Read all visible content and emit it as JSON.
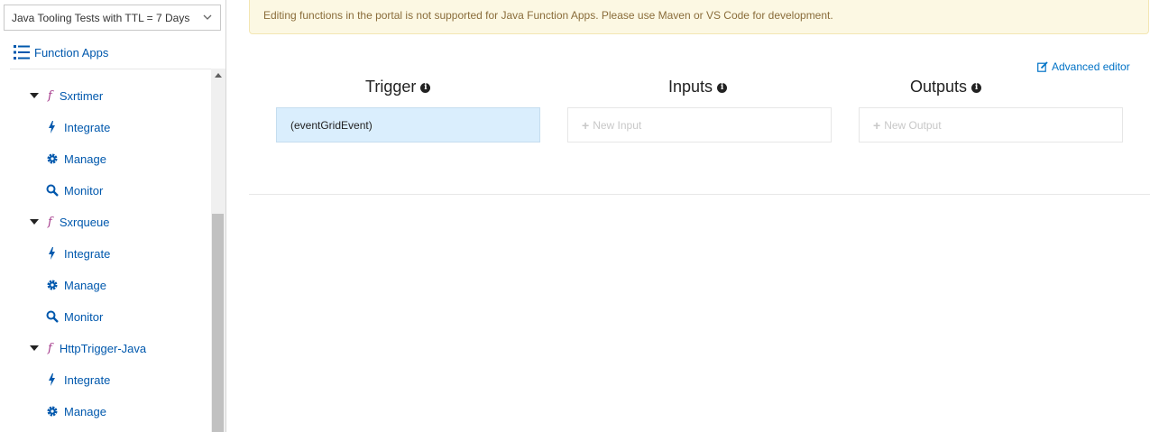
{
  "sidebar": {
    "subscription": "Java Tooling Tests with TTL = 7 Days",
    "header_label": "Function Apps",
    "tree": [
      {
        "kind": "function",
        "label": "Sxrtimer"
      },
      {
        "kind": "action",
        "icon": "lightning-icon",
        "label": "Integrate"
      },
      {
        "kind": "action",
        "icon": "gear-icon",
        "label": "Manage"
      },
      {
        "kind": "action",
        "icon": "search-icon",
        "label": "Monitor"
      },
      {
        "kind": "function",
        "label": "Sxrqueue"
      },
      {
        "kind": "action",
        "icon": "lightning-icon",
        "label": "Integrate"
      },
      {
        "kind": "action",
        "icon": "gear-icon",
        "label": "Manage"
      },
      {
        "kind": "action",
        "icon": "search-icon",
        "label": "Monitor"
      },
      {
        "kind": "function",
        "label": "HttpTrigger-Java"
      },
      {
        "kind": "action",
        "icon": "lightning-icon",
        "label": "Integrate"
      },
      {
        "kind": "action",
        "icon": "gear-icon",
        "label": "Manage"
      }
    ]
  },
  "main": {
    "banner": "Editing functions in the portal is not supported for Java Function Apps. Please use Maven or VS Code for development.",
    "advanced_editor": "Advanced editor",
    "trigger": {
      "title": "Trigger",
      "value": "(eventGridEvent)"
    },
    "inputs": {
      "title": "Inputs",
      "new_label": "New Input"
    },
    "outputs": {
      "title": "Outputs",
      "new_label": "New Output"
    }
  },
  "colors": {
    "link": "#0058ad",
    "banner_bg": "#fcf8e3",
    "banner_text": "#8a6d3b",
    "trigger_bg": "#daeefd",
    "function_icon": "#a4388a"
  }
}
